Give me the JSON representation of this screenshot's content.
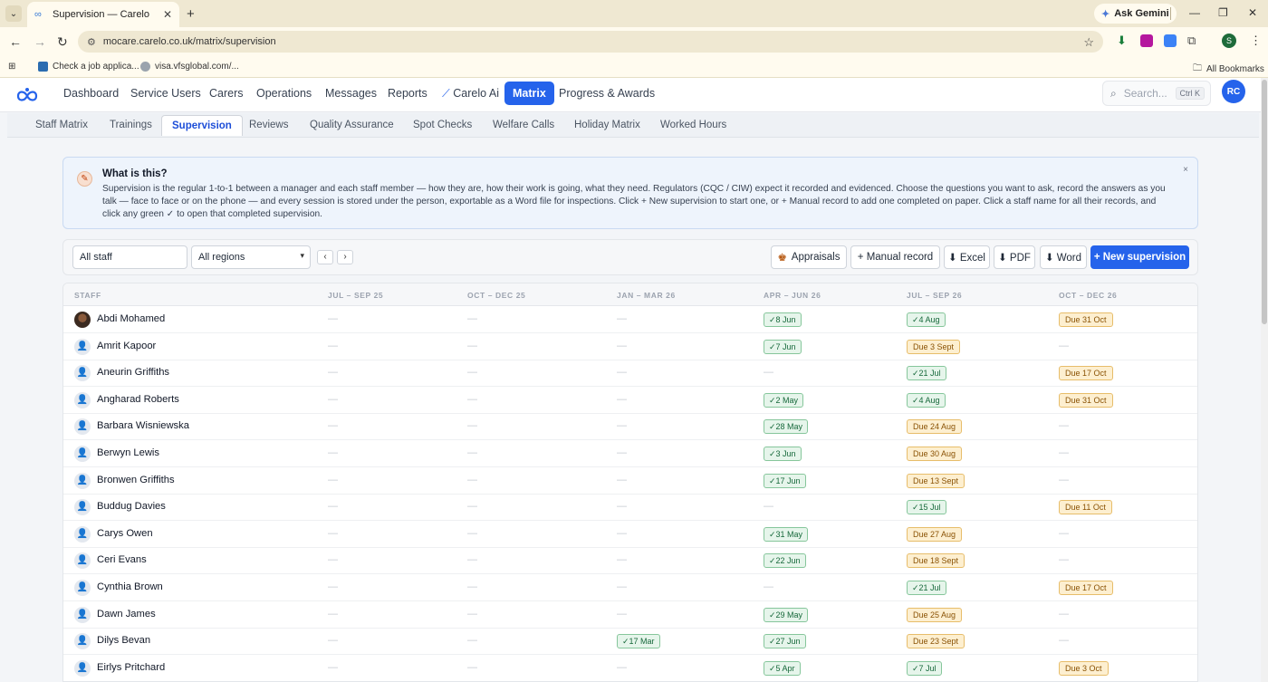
{
  "browser": {
    "tab_title": "Supervision — Carelo",
    "gemini_label": "Ask Gemini",
    "url": "mocare.carelo.co.uk/matrix/supervision",
    "profile_initial": "S",
    "bookmarks": [
      "Check a job applica...",
      "visa.vfsglobal.com/...",
      "All Bookmarks"
    ]
  },
  "app": {
    "nav": [
      "Dashboard",
      "Service Users",
      "Carers",
      "Operations",
      "Messages",
      "Reports",
      "Carelo Ai",
      "Matrix",
      "Progress & Awards"
    ],
    "active_nav": "Matrix",
    "search_placeholder": "Search...",
    "search_shortcut": "Ctrl K",
    "user_initials": "RC",
    "subnav": [
      "Staff Matrix",
      "Trainings",
      "Supervision",
      "Reviews",
      "Quality Assurance",
      "Spot Checks",
      "Welfare Calls",
      "Holiday Matrix",
      "Worked Hours"
    ],
    "active_subnav": "Supervision"
  },
  "info": {
    "title": "What is this?",
    "text": "Supervision is the regular 1-to-1 between a manager and each staff member — how they are, how their work is going, what they need. Regulators (CQC / CIW) expect it recorded and evidenced. Choose the questions you want to ask, record the answers as you talk — face to face or on the phone — and every session is stored under the person, exportable as a Word file for inspections. Click + New supervision to start one, or + Manual record to add one completed on paper. Click a staff name for all their records, and click any green ✓ to open that completed supervision.",
    "close": "×"
  },
  "toolbar": {
    "staff_filter": "All staff",
    "region_filter": "All regions",
    "prev": "‹",
    "next": "›",
    "appraisals": "Appraisals",
    "manual_record": "+ Manual record",
    "excel": "⬇ Excel",
    "pdf": "⬇ PDF",
    "word": "⬇ Word",
    "new_supervision": "+ New supervision"
  },
  "table": {
    "headers": [
      "STAFF",
      "JUL – SEP 25",
      "OCT – DEC 25",
      "JAN – MAR 26",
      "APR – JUN 26",
      "JUL – SEP 26",
      "OCT – DEC 26"
    ],
    "rows": [
      {
        "name": "Abdi Mohamed",
        "photo": true,
        "cells": [
          "—",
          "—",
          "—",
          "✓8 Jun",
          "✓4 Aug",
          "Due 31 Oct"
        ]
      },
      {
        "name": "Amrit Kapoor",
        "cells": [
          "—",
          "—",
          "—",
          "✓7 Jun",
          "Due 3 Sept",
          "—"
        ]
      },
      {
        "name": "Aneurin Griffiths",
        "cells": [
          "—",
          "—",
          "—",
          "—",
          "✓21 Jul",
          "Due 17 Oct"
        ]
      },
      {
        "name": "Angharad Roberts",
        "cells": [
          "—",
          "—",
          "—",
          "✓2 May",
          "✓4 Aug",
          "Due 31 Oct"
        ]
      },
      {
        "name": "Barbara Wisniewska",
        "cells": [
          "—",
          "—",
          "—",
          "✓28 May",
          "Due 24 Aug",
          "—"
        ]
      },
      {
        "name": "Berwyn Lewis",
        "cells": [
          "—",
          "—",
          "—",
          "✓3 Jun",
          "Due 30 Aug",
          "—"
        ]
      },
      {
        "name": "Bronwen Griffiths",
        "cells": [
          "—",
          "—",
          "—",
          "✓17 Jun",
          "Due 13 Sept",
          "—"
        ]
      },
      {
        "name": "Buddug Davies",
        "cells": [
          "—",
          "—",
          "—",
          "—",
          "✓15 Jul",
          "Due 11 Oct"
        ]
      },
      {
        "name": "Carys Owen",
        "cells": [
          "—",
          "—",
          "—",
          "✓31 May",
          "Due 27 Aug",
          "—"
        ]
      },
      {
        "name": "Ceri Evans",
        "cells": [
          "—",
          "—",
          "—",
          "✓22 Jun",
          "Due 18 Sept",
          "—"
        ]
      },
      {
        "name": "Cynthia Brown",
        "cells": [
          "—",
          "—",
          "—",
          "—",
          "✓21 Jul",
          "Due 17 Oct"
        ]
      },
      {
        "name": "Dawn James",
        "cells": [
          "—",
          "—",
          "—",
          "✓29 May",
          "Due 25 Aug",
          "—"
        ]
      },
      {
        "name": "Dilys Bevan",
        "cells": [
          "—",
          "—",
          "✓17 Mar",
          "✓27 Jun",
          "Due 23 Sept",
          "—"
        ]
      },
      {
        "name": "Eirlys Pritchard",
        "cells": [
          "—",
          "—",
          "—",
          "✓5 Apr",
          "✓7 Jul",
          "Due 3 Oct"
        ]
      }
    ]
  },
  "colors": {
    "primary": "#2563eb",
    "done_bg": "#e6f5eb",
    "due_bg": "#fdefd0"
  }
}
